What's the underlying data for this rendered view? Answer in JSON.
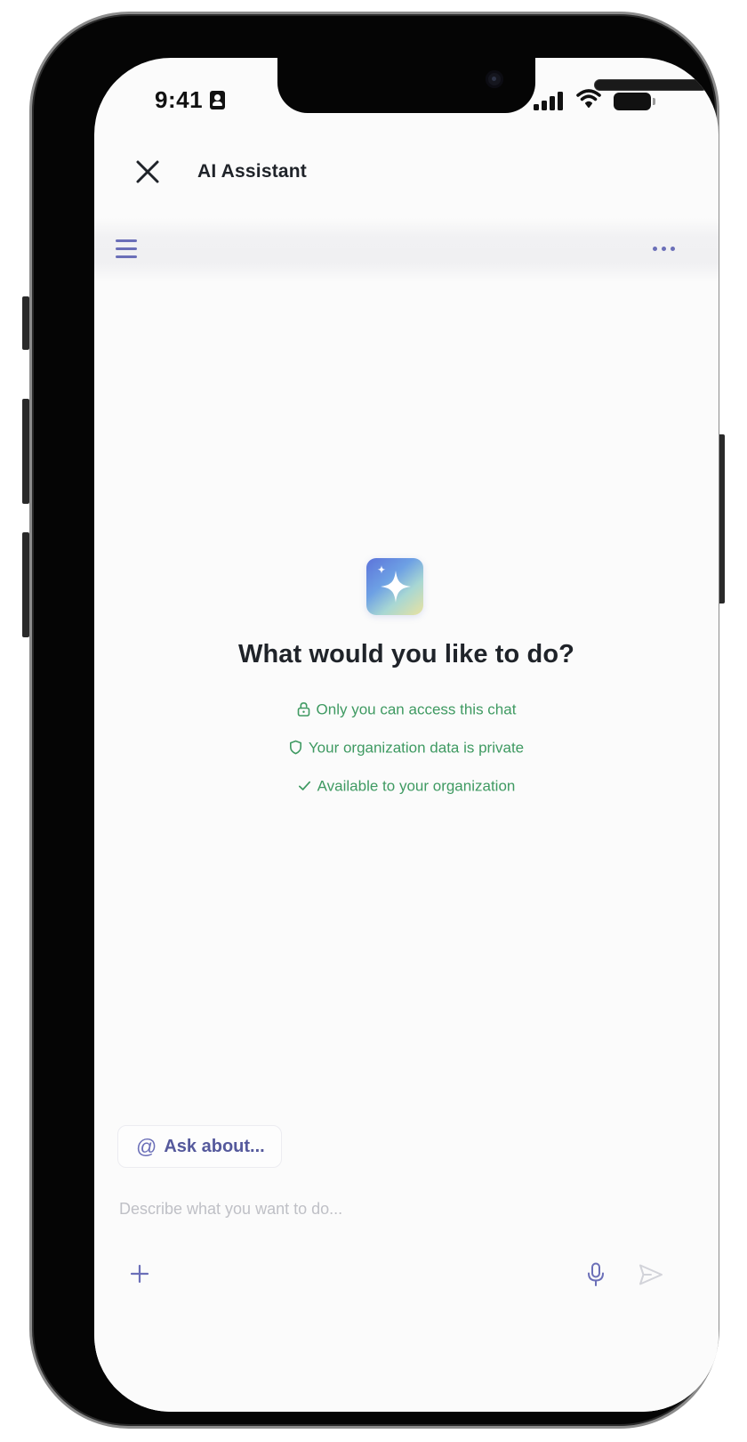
{
  "status_bar": {
    "time": "9:41",
    "icons": [
      "contact-card-icon",
      "signal-icon",
      "wifi-icon",
      "battery-icon"
    ]
  },
  "header": {
    "title": "AI Assistant",
    "close_icon": "close-icon"
  },
  "toolbar": {
    "left_icon": "menu-icon",
    "right_icon": "more-icon"
  },
  "main": {
    "logo_icon": "sparkle-icon",
    "heading": "What would you like to do?",
    "info_items": [
      {
        "icon": "lock-icon",
        "text": "Only you can access this chat"
      },
      {
        "icon": "shield-icon",
        "text": "Your organization data is private"
      },
      {
        "icon": "check-icon",
        "text": "Available to your organization"
      }
    ]
  },
  "composer": {
    "chip_label": "Ask about...",
    "chip_icon": "at-icon",
    "input_placeholder": "Describe what you want to do...",
    "input_value": "",
    "icons": [
      "add-icon",
      "mic-icon",
      "send-icon"
    ]
  },
  "colors": {
    "accent": "#6b6fb8",
    "success_text": "#3f9a62",
    "heading_text": "#1f2329",
    "placeholder": "#bfc0c6"
  }
}
